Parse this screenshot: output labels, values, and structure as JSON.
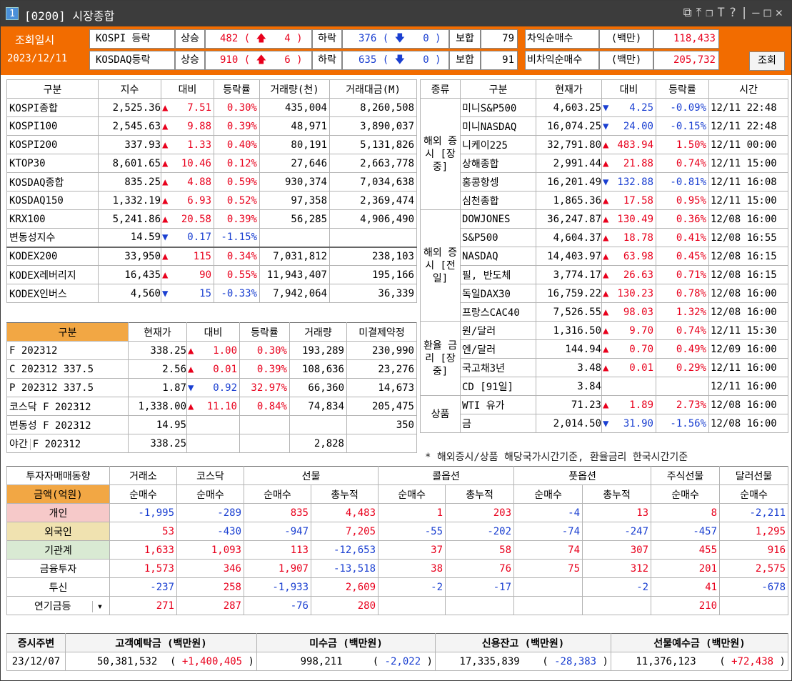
{
  "window": {
    "num": "1",
    "title": "[0200] 시장종합",
    "icons": [
      "restore-icon",
      "pin-icon",
      "window-icon",
      "font-icon",
      "help-icon",
      "minimize-icon",
      "maximize-icon",
      "close-icon"
    ]
  },
  "header": {
    "date_label": "조회일시",
    "date": "2023/12/11",
    "kospi_label": "KOSPI 등락",
    "kosdaq_label": "KOSDAQ등락",
    "up": "상승",
    "down": "하락",
    "flat": "보합",
    "kospi": {
      "up": "482",
      "up_limit": "4",
      "down": "376",
      "down_limit": "0",
      "flat": "79"
    },
    "kosdaq": {
      "up": "910",
      "up_limit": "6",
      "down": "635",
      "down_limit": "0",
      "flat": "91"
    },
    "arb_label": "차익순매수",
    "nonarb_label": "비차익순매수",
    "unit": "(백만)",
    "arb": "118,433",
    "nonarb": "205,732",
    "query": "조회"
  },
  "index": {
    "headers": [
      "구분",
      "지수",
      "대비",
      "등락률",
      "거래량(천)",
      "거래대금(M)"
    ],
    "rows": [
      [
        "KOSPI종합",
        "2,525.36",
        "▲",
        "7.51",
        "0.30%",
        "435,004",
        "8,260,508"
      ],
      [
        "KOSPI100",
        "2,545.63",
        "▲",
        "9.88",
        "0.39%",
        "48,971",
        "3,890,037"
      ],
      [
        "KOSPI200",
        "337.93",
        "▲",
        "1.33",
        "0.40%",
        "80,191",
        "5,131,826"
      ],
      [
        "KTOP30",
        "8,601.65",
        "▲",
        "10.46",
        "0.12%",
        "27,646",
        "2,663,778"
      ],
      [
        "KOSDAQ종합",
        "835.25",
        "▲",
        "4.88",
        "0.59%",
        "930,374",
        "7,034,638"
      ],
      [
        "KOSDAQ150",
        "1,332.19",
        "▲",
        "6.93",
        "0.52%",
        "97,358",
        "2,369,474"
      ],
      [
        "KRX100",
        "5,241.86",
        "▲",
        "20.58",
        "0.39%",
        "56,285",
        "4,906,490"
      ],
      [
        "변동성지수",
        "14.59",
        "▼",
        "0.17",
        "-1.15%",
        "",
        ""
      ],
      [
        "KODEX200",
        "33,950",
        "▲",
        "115",
        "0.34%",
        "7,031,812",
        "238,103"
      ],
      [
        "KODEX레버리지",
        "16,435",
        "▲",
        "90",
        "0.55%",
        "11,943,407",
        "195,166"
      ],
      [
        "KODEX인버스",
        "4,560",
        "▼",
        "15",
        "-0.33%",
        "7,942,064",
        "36,339"
      ]
    ]
  },
  "futures": {
    "headers": [
      "구분",
      "현재가",
      "대비",
      "등락률",
      "거래량",
      "미결제약정"
    ],
    "rows": [
      [
        "F 202312",
        "338.25",
        "▲",
        "1.00",
        "0.30%",
        "193,289",
        "230,990"
      ],
      [
        "C 202312 337.5",
        "2.56",
        "▲",
        "0.01",
        "0.39%",
        "108,636",
        "23,276"
      ],
      [
        "P 202312 337.5",
        "1.87",
        "▼",
        "0.92",
        "32.97%",
        "66,360",
        "14,673"
      ],
      [
        "코스닥 F 202312",
        "1,338.00",
        "▲",
        "11.10",
        "0.84%",
        "74,834",
        "205,475"
      ],
      [
        "변동성 F 202312",
        "14.95",
        "",
        "",
        "",
        "",
        "350"
      ],
      [
        "F 202312",
        "338.25",
        "",
        "",
        "",
        "2,828",
        ""
      ]
    ],
    "night_label": "야간"
  },
  "world": {
    "headers": [
      "종류",
      "구분",
      "현재가",
      "대비",
      "등락률",
      "시간"
    ],
    "groups": [
      {
        "name": "해외 증시 [장중]",
        "rows": [
          [
            "미니S&P500",
            "4,603.25",
            "▼",
            "4.25",
            "-0.09%",
            "12/11 22:48"
          ],
          [
            "미니NASDAQ",
            "16,074.25",
            "▼",
            "24.00",
            "-0.15%",
            "12/11 22:48"
          ],
          [
            "니케이225",
            "32,791.80",
            "▲",
            "483.94",
            "1.50%",
            "12/11 00:00"
          ],
          [
            "상해종합",
            "2,991.44",
            "▲",
            "21.88",
            "0.74%",
            "12/11 15:00"
          ],
          [
            "홍콩항셍",
            "16,201.49",
            "▼",
            "132.88",
            "-0.81%",
            "12/11 16:08"
          ],
          [
            "심천종합",
            "1,865.36",
            "▲",
            "17.58",
            "0.95%",
            "12/11 15:00"
          ]
        ]
      },
      {
        "name": "해외 증시 [전일]",
        "rows": [
          [
            "DOWJONES",
            "36,247.87",
            "▲",
            "130.49",
            "0.36%",
            "12/08 16:00"
          ],
          [
            "S&P500",
            "4,604.37",
            "▲",
            "18.78",
            "0.41%",
            "12/08 16:55"
          ],
          [
            "NASDAQ",
            "14,403.97",
            "▲",
            "63.98",
            "0.45%",
            "12/08 16:15"
          ],
          [
            "필, 반도체",
            "3,774.17",
            "▲",
            "26.63",
            "0.71%",
            "12/08 16:15"
          ],
          [
            "독일DAX30",
            "16,759.22",
            "▲",
            "130.23",
            "0.78%",
            "12/08 16:00"
          ],
          [
            "프랑스CAC40",
            "7,526.55",
            "▲",
            "98.03",
            "1.32%",
            "12/08 16:00"
          ]
        ]
      },
      {
        "name": "환율 금리 [장중]",
        "rows": [
          [
            "원/달러",
            "1,316.50",
            "▲",
            "9.70",
            "0.74%",
            "12/11 15:30"
          ],
          [
            "엔/달러",
            "144.94",
            "▲",
            "0.70",
            "0.49%",
            "12/09 16:00"
          ],
          [
            "국고채3년",
            "3.48",
            "▲",
            "0.01",
            "0.29%",
            "12/11 16:00"
          ],
          [
            "CD [91일]",
            "3.84",
            "",
            "",
            "",
            "12/11 16:00"
          ]
        ]
      },
      {
        "name": "상품",
        "rows": [
          [
            "WTI 유가",
            "71.23",
            "▲",
            "1.89",
            "2.73%",
            "12/08 16:00"
          ],
          [
            "금",
            "2,014.50",
            "▼",
            "31.90",
            "-1.56%",
            "12/08 16:00"
          ]
        ]
      }
    ],
    "note": "* 해외증시/상품 해당국가시간기준, 환율금리 한국시간기준"
  },
  "investor": {
    "title": "투자자매매동향",
    "unit": "금액(억원)",
    "cols": [
      "거래소",
      "코스닥",
      "선물",
      "콜옵션",
      "풋옵션",
      "주식선물",
      "달러선물"
    ],
    "sub": [
      "순매수",
      "순매수",
      "순매수",
      "총누적",
      "순매수",
      "총누적",
      "순매수",
      "총누적",
      "순매수",
      "순매수"
    ],
    "rows": [
      {
        "name": "개인",
        "bg": "#f6c9c9",
        "v": [
          "-1,995",
          "-289",
          "835",
          "4,483",
          "1",
          "203",
          "-4",
          "13",
          "8",
          "-2,211"
        ]
      },
      {
        "name": "외국인",
        "bg": "#f0e2b0",
        "v": [
          "53",
          "-430",
          "-947",
          "7,205",
          "-55",
          "-202",
          "-74",
          "-247",
          "-457",
          "1,295"
        ]
      },
      {
        "name": "기관계",
        "bg": "#d9ead3",
        "v": [
          "1,633",
          "1,093",
          "113",
          "-12,653",
          "37",
          "58",
          "74",
          "307",
          "455",
          "916"
        ]
      },
      {
        "name": "금융투자",
        "bg": "#fff",
        "v": [
          "1,573",
          "346",
          "1,907",
          "-13,518",
          "38",
          "76",
          "75",
          "312",
          "201",
          "2,575"
        ]
      },
      {
        "name": "투신",
        "bg": "#fff",
        "v": [
          "-237",
          "258",
          "-1,933",
          "2,609",
          "-2",
          "-17",
          "",
          "-2",
          "41",
          "-678"
        ]
      },
      {
        "name": "연기금등",
        "bg": "#fff",
        "v": [
          "271",
          "287",
          "-76",
          "280",
          "",
          "",
          "",
          "",
          "210",
          ""
        ]
      }
    ]
  },
  "bottom": {
    "headers": [
      "증시주변",
      "고객예탁금 (백만원)",
      "미수금 (백만원)",
      "신용잔고 (백만원)",
      "선물예수금 (백만원)"
    ],
    "date": "23/12/07",
    "deposit": "50,381,532",
    "deposit_chg": "+1,400,405",
    "unpaid": "998,211",
    "unpaid_chg": "-2,022",
    "credit": "17,335,839",
    "credit_chg": "-28,383",
    "fut": "11,376,123",
    "fut_chg": "+72,438"
  }
}
